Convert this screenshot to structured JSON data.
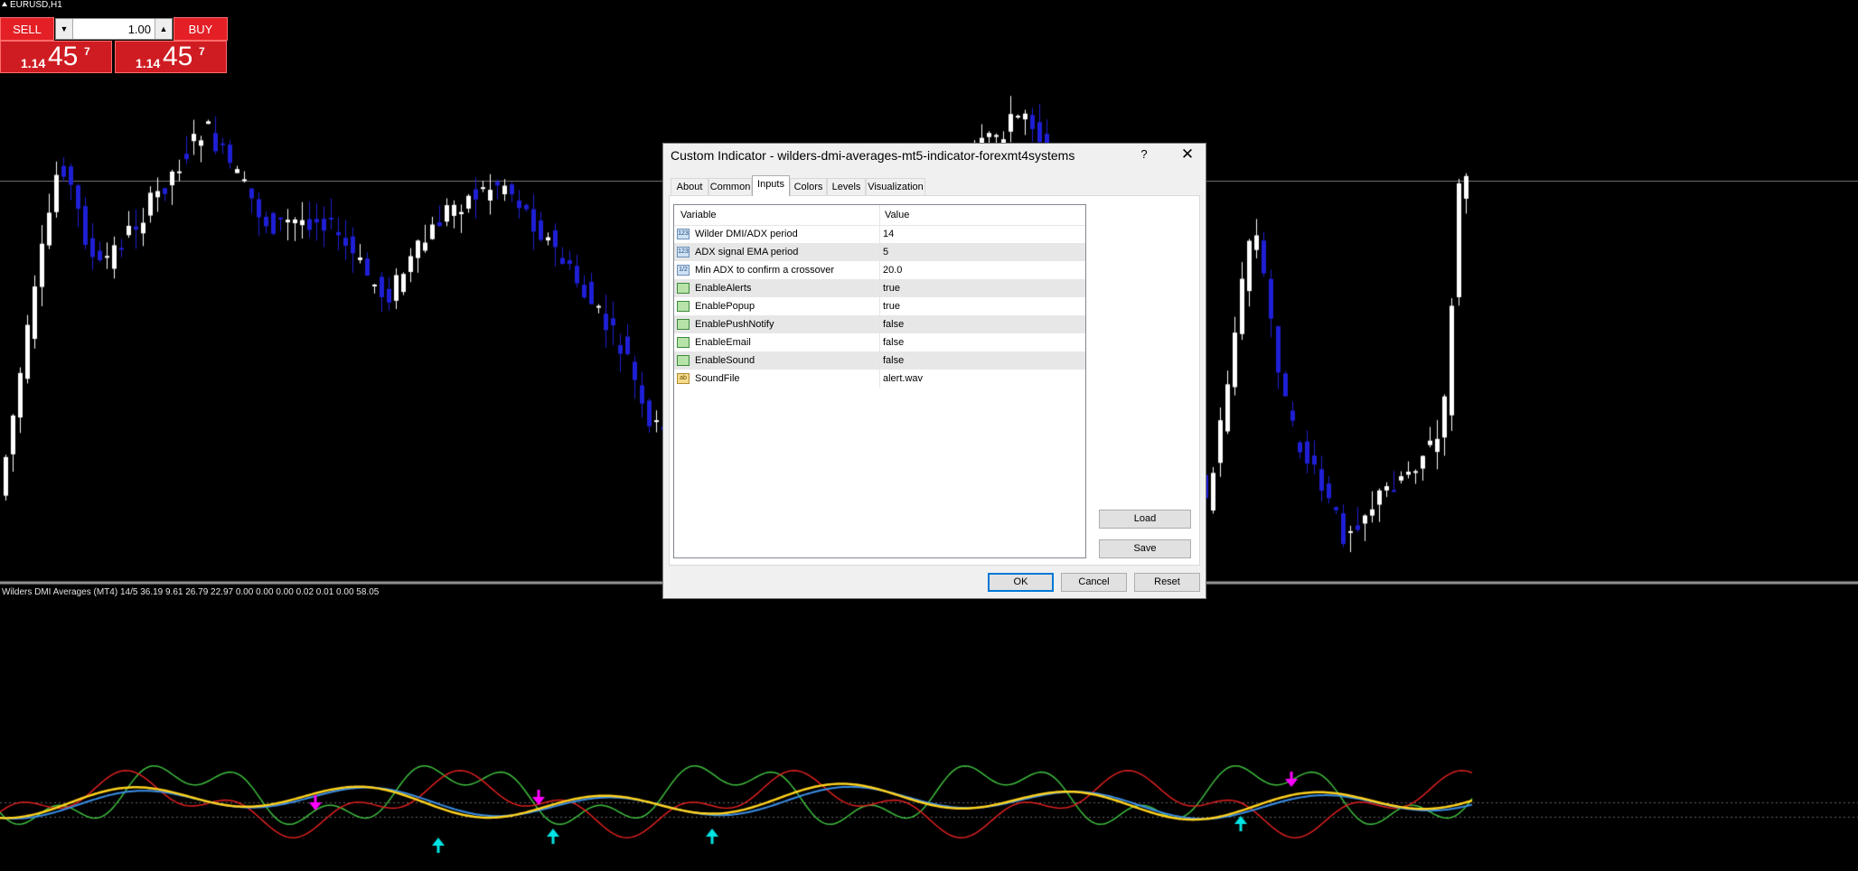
{
  "chart": {
    "symbol": "EURUSD,H1",
    "indicator_label": "Wilders DMI Averages (MT4) 14/5 36.19 9.61 26.79 22.97 0.00 0.00 0.00 0.02 0.01 0.00 58.05"
  },
  "trade_panel": {
    "sell_label": "SELL",
    "buy_label": "BUY",
    "volume": "1.00",
    "sell_price": {
      "small": "1.14",
      "big": "45",
      "sup": "7"
    },
    "buy_price": {
      "small": "1.14",
      "big": "45",
      "sup": "7"
    }
  },
  "colors": {
    "bull_candle": "#ffffff",
    "bear_candle": "#1f1fd6",
    "plus_di": "#3fbf3f",
    "minus_di": "#e02020",
    "adx": "#ffd21e",
    "signal": "#3a8ee6",
    "sell_arrow": "#ff00ff",
    "buy_arrow": "#00e5e5",
    "sell_button": "#e41f26"
  },
  "dialog": {
    "title": "Custom Indicator - wilders-dmi-averages-mt5-indicator-forexmt4systems",
    "help": "?",
    "close": "✕",
    "tabs": [
      {
        "label": "About"
      },
      {
        "label": "Common"
      },
      {
        "label": "Inputs"
      },
      {
        "label": "Colors"
      },
      {
        "label": "Levels"
      },
      {
        "label": "Visualization"
      }
    ],
    "grid": {
      "col_variable": "Variable",
      "col_value": "Value",
      "rows": [
        {
          "icon": "123",
          "variable": "Wilder DMI/ADX period",
          "value": "14"
        },
        {
          "icon": "123",
          "variable": "ADX signal EMA period",
          "value": "5"
        },
        {
          "icon": "1/2",
          "variable": "Min ADX to confirm a crossover",
          "value": "20.0"
        },
        {
          "icon": "bool",
          "variable": "EnableAlerts",
          "value": "true"
        },
        {
          "icon": "bool",
          "variable": "EnablePopup",
          "value": "true"
        },
        {
          "icon": "bool",
          "variable": "EnablePushNotify",
          "value": "false"
        },
        {
          "icon": "bool",
          "variable": "EnableEmail",
          "value": "false"
        },
        {
          "icon": "bool",
          "variable": "EnableSound",
          "value": "false"
        },
        {
          "icon": "ab",
          "variable": "SoundFile",
          "value": "alert.wav"
        }
      ]
    },
    "load_label": "Load",
    "save_label": "Save",
    "ok_label": "OK",
    "cancel_label": "Cancel",
    "reset_label": "Reset"
  }
}
